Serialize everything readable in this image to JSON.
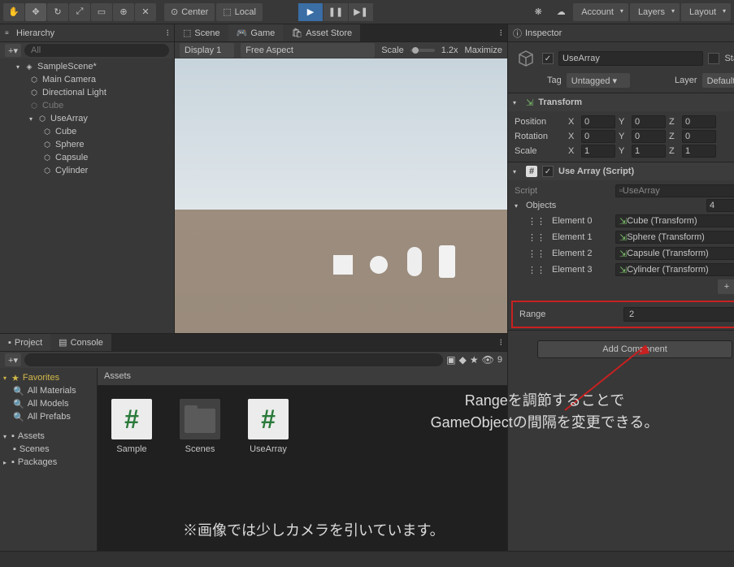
{
  "toolbar": {
    "pivot_label": "Center",
    "handle_label": "Local",
    "account_label": "Account",
    "layers_label": "Layers",
    "layout_label": "Layout"
  },
  "hierarchy": {
    "title": "Hierarchy",
    "search_placeholder": "All",
    "scene": "SampleScene*",
    "items": [
      "Main Camera",
      "Directional Light",
      "Cube",
      "UseArray"
    ],
    "children": [
      "Cube",
      "Sphere",
      "Capsule",
      "Cylinder"
    ]
  },
  "scene_tabs": {
    "scene": "Scene",
    "game": "Game",
    "asset_store": "Asset Store"
  },
  "game_toolbar": {
    "display": "Display 1",
    "aspect": "Free Aspect",
    "scale_label": "Scale",
    "scale_value": "1.2x",
    "maximize": "Maximize"
  },
  "project": {
    "project_tab": "Project",
    "console_tab": "Console",
    "favorites": "Favorites",
    "fav_items": [
      "All Materials",
      "All Models",
      "All Prefabs"
    ],
    "assets_label": "Assets",
    "assets_children": [
      "Scenes"
    ],
    "packages_label": "Packages",
    "grid_header": "Assets",
    "items": [
      "Sample",
      "Scenes",
      "UseArray"
    ],
    "search_count": "9"
  },
  "inspector": {
    "title": "Inspector",
    "go_name": "UseArray",
    "static_label": "Static",
    "tag_label": "Tag",
    "tag_value": "Untagged",
    "layer_label": "Layer",
    "layer_value": "Default",
    "transform": {
      "title": "Transform",
      "position": "Position",
      "rotation": "Rotation",
      "scale": "Scale",
      "x": "X",
      "y": "Y",
      "z": "Z",
      "px": "0",
      "py": "0",
      "pz": "0",
      "rx": "0",
      "ry": "0",
      "rz": "0",
      "sx": "1",
      "sy": "1",
      "sz": "1"
    },
    "script": {
      "title": "Use Array (Script)",
      "script_label": "Script",
      "script_value": "UseArray",
      "objects_label": "Objects",
      "objects_count": "4",
      "elements": [
        {
          "label": "Element 0",
          "value": "Cube (Transform)"
        },
        {
          "label": "Element 1",
          "value": "Sphere (Transform)"
        },
        {
          "label": "Element 2",
          "value": "Capsule (Transform)"
        },
        {
          "label": "Element 3",
          "value": "Cylinder (Transform)"
        }
      ],
      "range_label": "Range",
      "range_value": "2"
    },
    "add_component": "Add Component"
  },
  "annotations": {
    "range_note": "Rangeを調節することで\nGameObjectの間隔を変更できる。",
    "camera_note": "※画像では少しカメラを引いています。"
  }
}
